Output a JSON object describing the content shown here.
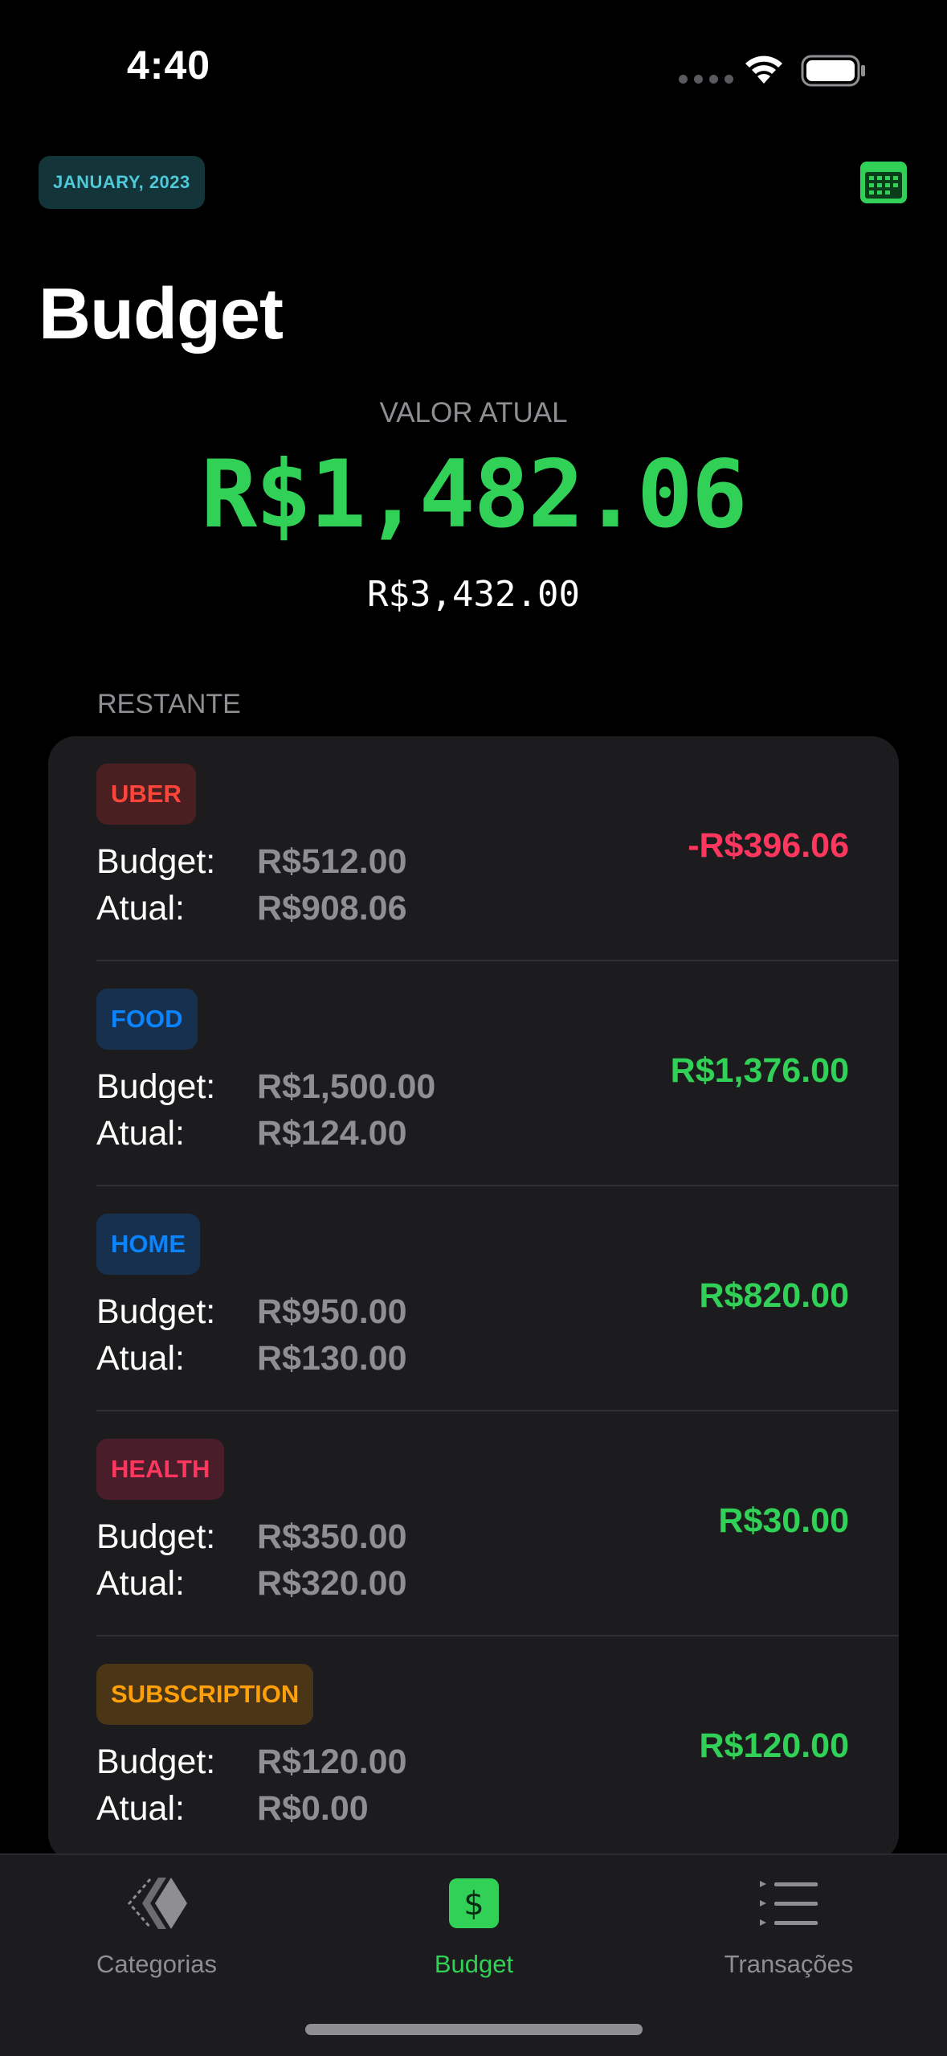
{
  "status_bar": {
    "time": "4:40"
  },
  "header": {
    "month": "JANUARY, 2023",
    "title": "Budget"
  },
  "summary": {
    "label": "VALOR ATUAL",
    "current_value": "R$1,482.06",
    "total_budget": "R$3,432.00"
  },
  "section_label": "RESTANTE",
  "labels": {
    "budget": "Budget:",
    "actual": "Atual:"
  },
  "categories": [
    {
      "name": "UBER",
      "budget": "R$512.00",
      "actual": "R$908.06",
      "remaining": "-R$396.06",
      "tag_bg": "#4a1f21",
      "tag_color": "#ff453a",
      "remaining_color": "#ff375f"
    },
    {
      "name": "FOOD",
      "budget": "R$1,500.00",
      "actual": "R$124.00",
      "remaining": "R$1,376.00",
      "tag_bg": "#16304d",
      "tag_color": "#0a84ff",
      "remaining_color": "#31d158"
    },
    {
      "name": "HOME",
      "budget": "R$950.00",
      "actual": "R$130.00",
      "remaining": "R$820.00",
      "tag_bg": "#16304d",
      "tag_color": "#0a84ff",
      "remaining_color": "#31d158"
    },
    {
      "name": "HEALTH",
      "budget": "R$350.00",
      "actual": "R$320.00",
      "remaining": "R$30.00",
      "tag_bg": "#4a1d2a",
      "tag_color": "#ff375f",
      "remaining_color": "#31d158"
    },
    {
      "name": "SUBSCRIPTION",
      "budget": "R$120.00",
      "actual": "R$0.00",
      "remaining": "R$120.00",
      "tag_bg": "#4a3516",
      "tag_color": "#ff9f0a",
      "remaining_color": "#31d158"
    }
  ],
  "tabbar": {
    "tabs": [
      {
        "label": "Categorias",
        "icon": "categories-icon",
        "active": false
      },
      {
        "label": "Budget",
        "icon": "dollar-icon",
        "active": true
      },
      {
        "label": "Transações",
        "icon": "list-icon",
        "active": false
      }
    ]
  },
  "colors": {
    "accent": "#31d158",
    "background": "#000000",
    "card": "#1c1c1e"
  }
}
